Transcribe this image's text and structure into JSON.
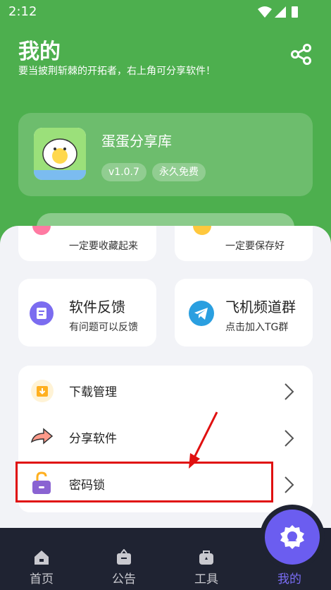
{
  "status_bar": {
    "time": "2:12"
  },
  "header": {
    "title": "我的",
    "subtitle": "要当披荆斩棘的开拓者，右上角可分享软件！"
  },
  "app": {
    "name": "蛋蛋分享库",
    "version": "v1.0.7",
    "license": "永久免费"
  },
  "feature_cards": [
    {
      "desc": "一定要收藏起来"
    },
    {
      "desc": "一定要保存好"
    },
    {
      "title": "软件反馈",
      "desc": "有问题可以反馈"
    },
    {
      "title": "飞机频道群",
      "desc": "点击加入TG群"
    }
  ],
  "menu": [
    {
      "label": "下载管理",
      "icon": "download-box-icon"
    },
    {
      "label": "分享软件",
      "icon": "share-arrow-icon"
    },
    {
      "label": "密码锁",
      "icon": "lock-icon"
    }
  ],
  "tabs": [
    {
      "label": "首页",
      "icon": "home-icon"
    },
    {
      "label": "公告",
      "icon": "notice-icon"
    },
    {
      "label": "工具",
      "icon": "toolbox-icon"
    },
    {
      "label": "我的",
      "icon": "profile-icon",
      "active": true
    }
  ],
  "colors": {
    "header_green": "#4daf4e",
    "tabbar": "#1f2332",
    "accent_purple": "#6b5df0",
    "highlight_red": "#e01010"
  }
}
